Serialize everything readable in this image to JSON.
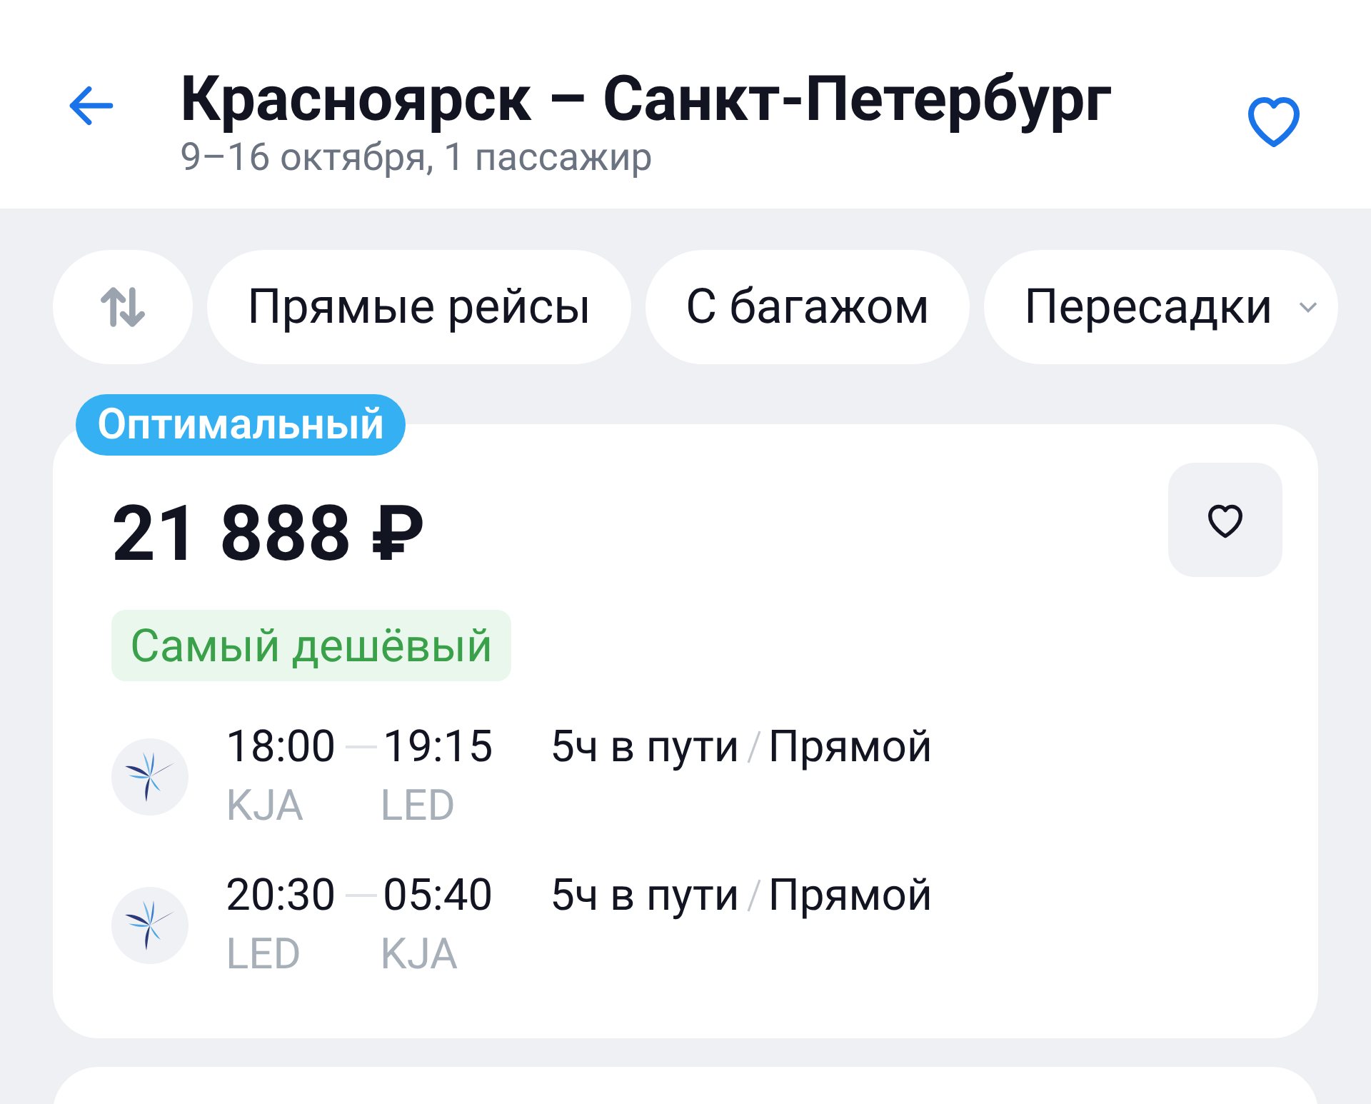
{
  "header": {
    "title": "Красноярск – Санкт-Петербург",
    "subtitle": "9–16 октября, 1 пассажир",
    "favorite": false
  },
  "filters": [
    {
      "kind": "sort"
    },
    {
      "kind": "chip",
      "label": "Прямые рейсы"
    },
    {
      "kind": "chip",
      "label": "С багажом"
    },
    {
      "kind": "dropdown",
      "label": "Пересадки"
    }
  ],
  "offer": {
    "badge": "Оптимальный",
    "price": "21 888 ₽",
    "tag": "Самый дешёвый",
    "favorite": false,
    "flights": [
      {
        "depart_time": "18:00",
        "arrive_time": "19:15",
        "from": "KJA",
        "to": "LED",
        "duration": "5ч в пути",
        "stops": "Прямой"
      },
      {
        "depart_time": "20:30",
        "arrive_time": "05:40",
        "from": "LED",
        "to": "KJA",
        "duration": "5ч в пути",
        "stops": "Прямой"
      }
    ]
  }
}
